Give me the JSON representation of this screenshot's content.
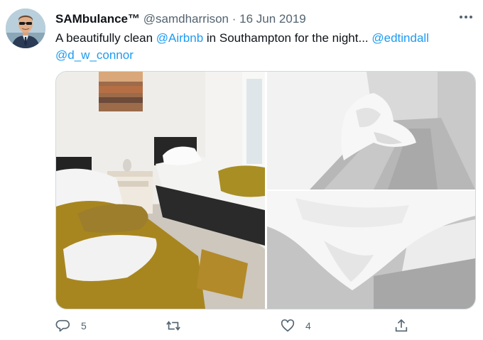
{
  "tweet": {
    "display_name": "SAMbulance™",
    "handle": "@samdharrison",
    "separator": "·",
    "date": "16 Jun 2019",
    "text_part1": "A beautifully clean ",
    "mention1": "@Airbnb",
    "text_part2": " in Southampton for the night... ",
    "mention2": "@edtindall",
    "mention3": "@d_w_connor"
  },
  "actions": {
    "reply_count": "5",
    "retweet_count": "",
    "like_count": "4"
  },
  "colors": {
    "link": "#1d9bf0",
    "secondary_text": "#536471",
    "primary_text": "#0f1419"
  },
  "icons": [
    "more-icon",
    "reply-icon",
    "retweet-icon",
    "like-icon",
    "share-icon"
  ]
}
